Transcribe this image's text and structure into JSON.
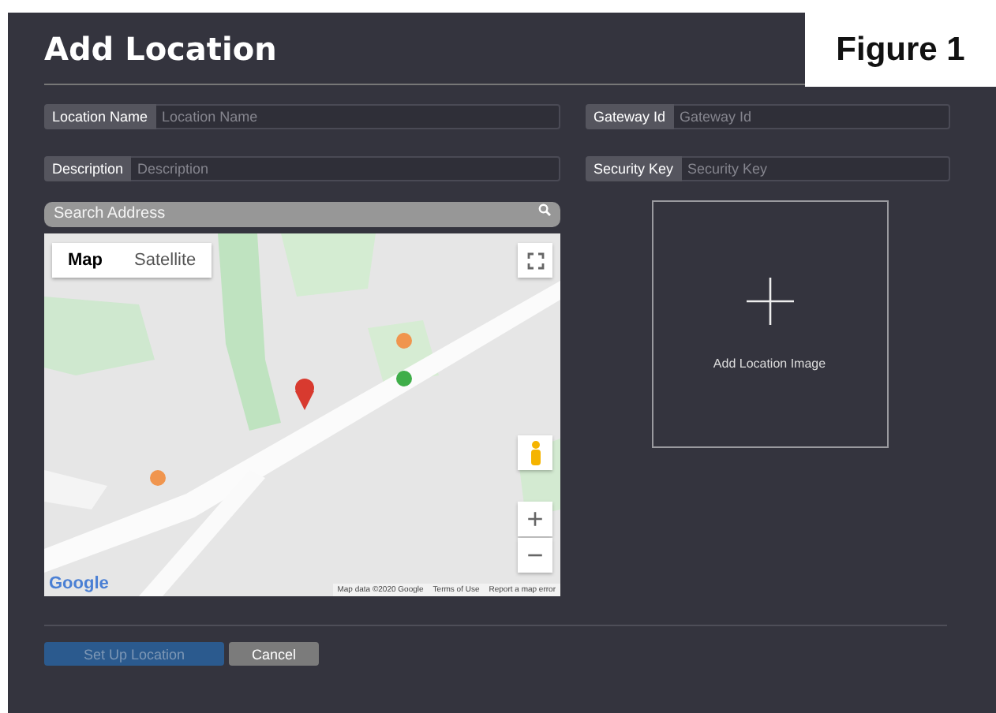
{
  "figure_label": "Figure 1",
  "title": "Add Location",
  "fields": [
    {
      "label": "Location Name",
      "placeholder": "Location Name"
    },
    {
      "label": "Gateway Id",
      "placeholder": "Gateway Id"
    },
    {
      "label": "Description",
      "placeholder": "Description"
    },
    {
      "label": "Security Key",
      "placeholder": "Security Key"
    }
  ],
  "search": {
    "placeholder": "Search Address"
  },
  "map": {
    "kind": "picture",
    "map_types": [
      {
        "label": "Map",
        "selected": true
      },
      {
        "label": "Satellite",
        "selected": false
      }
    ],
    "zoom_in": "+",
    "zoom_out": "−",
    "brand": "Google",
    "attribution": [
      "Map data ©2020 Google",
      "Terms of Use",
      "Report a map error"
    ]
  },
  "image_upload": {
    "label": "Add Location Image"
  },
  "buttons": [
    {
      "label": "Set Up Location",
      "kind": "primary",
      "disabled": true
    },
    {
      "label": "Cancel",
      "kind": "secondary",
      "disabled": false
    }
  ]
}
